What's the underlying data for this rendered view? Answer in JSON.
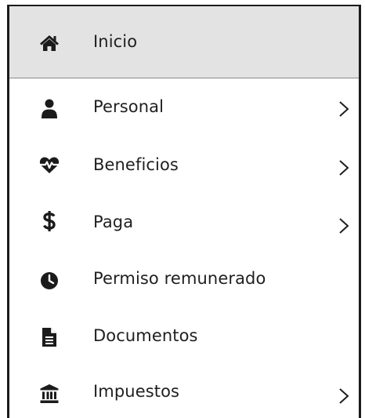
{
  "menu": {
    "items": [
      {
        "label": "Inicio",
        "icon": "home-icon",
        "has_submenu": false,
        "active": true
      },
      {
        "label": "Personal",
        "icon": "user-icon",
        "has_submenu": true,
        "active": false
      },
      {
        "label": "Beneficios",
        "icon": "heart-pulse-icon",
        "has_submenu": true,
        "active": false
      },
      {
        "label": "Paga",
        "icon": "dollar-icon",
        "has_submenu": true,
        "active": false
      },
      {
        "label": "Permiso remunerado",
        "icon": "clock-icon",
        "has_submenu": false,
        "active": false
      },
      {
        "label": "Documentos",
        "icon": "document-icon",
        "has_submenu": false,
        "active": false
      },
      {
        "label": "Impuestos",
        "icon": "bank-icon",
        "has_submenu": true,
        "active": false
      }
    ],
    "colors": {
      "active_background": "#e3e3e3",
      "text": "#1f1f1f",
      "icon": "#1b1b1b"
    }
  }
}
